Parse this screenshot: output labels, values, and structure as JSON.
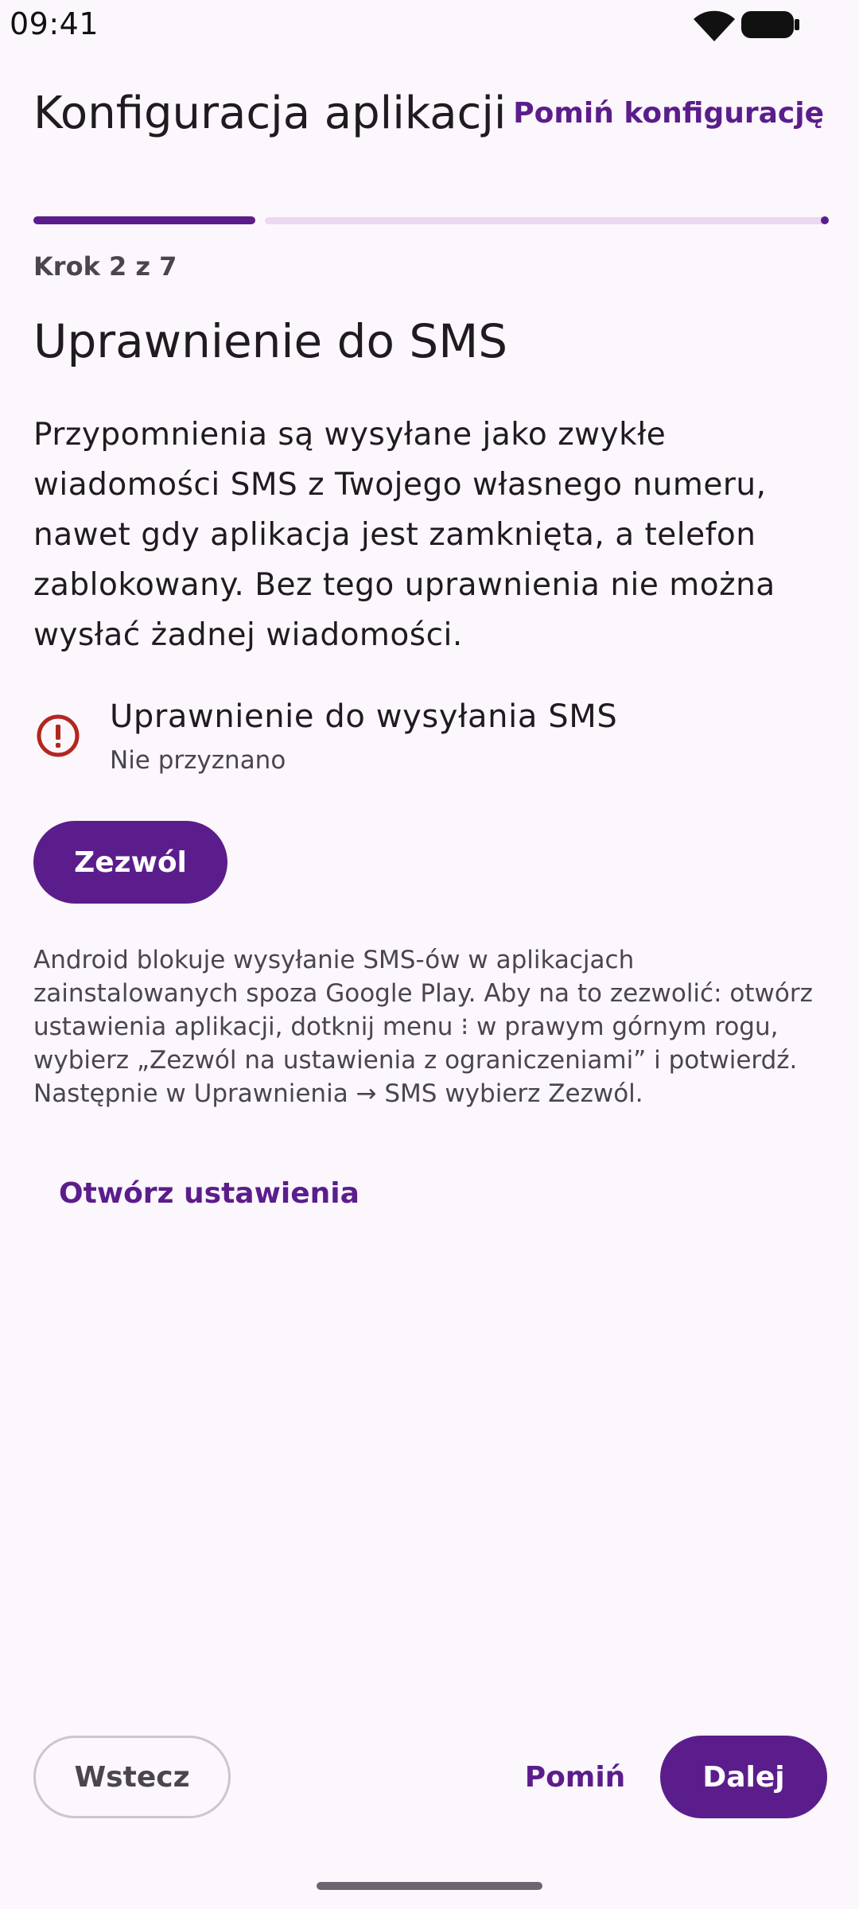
{
  "status_bar": {
    "time": "09:41",
    "icons": [
      "wifi-icon",
      "battery-icon"
    ]
  },
  "header": {
    "title": "Konfiguracja aplikacji",
    "skip_all_label": "Pomiń konfigurację"
  },
  "progress": {
    "current_step": 2,
    "total_steps": 7,
    "step_label": "Krok 2 z 7"
  },
  "permission_step": {
    "title": "Uprawnienie do SMS",
    "description": "Przypomnienia są wysyłane jako zwykłe wiadomości SMS z Twojego własnego numeru, nawet gdy aplikacja jest zamknięta, a telefon zablokowany. Bez tego uprawnienia nie można wysłać żadnej wiadomości.",
    "permission_name": "Uprawnienie do wysyłania SMS",
    "permission_status": "Nie przyznano",
    "status_icon": "alert-circle-icon",
    "allow_label": "Zezwól",
    "info_text": "Android blokuje wysyłanie SMS-ów w aplikacjach zainstalowanych spoza Google Play. Aby na to zezwolić: otwórz ustawienia aplikacji, dotknij menu ⁝ w prawym górnym rogu, wybierz „Zezwól na ustawienia z ograniczeniami” i potwierdź. Następnie w Uprawnienia → SMS wybierz Zezwól.",
    "open_settings_label": "Otwórz ustawienia"
  },
  "footer": {
    "back_label": "Wstecz",
    "skip_label": "Pomiń",
    "next_label": "Dalej"
  },
  "colors": {
    "primary": "#5b1d8c",
    "background": "#fcf7fc",
    "error": "#b3261e",
    "track": "#ead9f0"
  }
}
